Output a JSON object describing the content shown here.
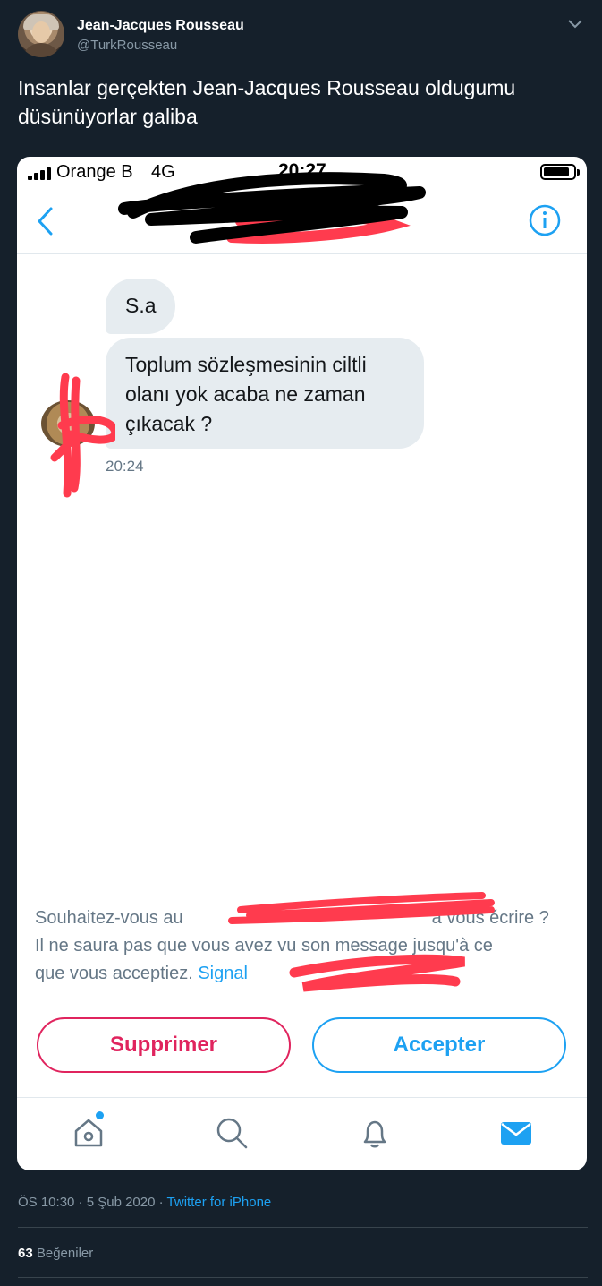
{
  "tweet": {
    "author_name": "Jean-Jacques Rousseau",
    "author_handle": "@TurkRousseau",
    "text": "Insanlar gerçekten Jean-Jacques Rousseau oldugumu düsünüyorlar galiba",
    "timestamp": "ÖS 10:30 · 5 Şub 2020",
    "client": "Twitter for iPhone",
    "likes_count": "63",
    "likes_label": "Beğeniler"
  },
  "screenshot": {
    "status_bar": {
      "carrier": "Orange B",
      "network": "4G",
      "time": "20:27"
    },
    "nav": {
      "title_visible_fragment": "uos"
    },
    "messages": [
      {
        "text": "S.a"
      },
      {
        "text": "Toplum sözleşmesinin ciltli olanı yok acaba ne zaman çıkacak ?"
      }
    ],
    "message_time": "20:24",
    "request": {
      "line_1_start": "Souhaitez-vous au",
      "line_1_end": "à vous écrire ?",
      "line_2": "Il ne saura pas que vous avez vu son message jusqu'à ce",
      "line_3": "que vous acceptiez. ",
      "link_fragment": "Signal"
    },
    "buttons": {
      "delete": "Supprimer",
      "accept": "Accepter"
    },
    "tabs": [
      "home-icon",
      "search-icon",
      "bell-icon",
      "mail-icon"
    ]
  },
  "colors": {
    "background": "#15202b",
    "accent_blue": "#1da1f2",
    "delete_red": "#e0245e",
    "scribble_red": "#ff3b4e"
  }
}
